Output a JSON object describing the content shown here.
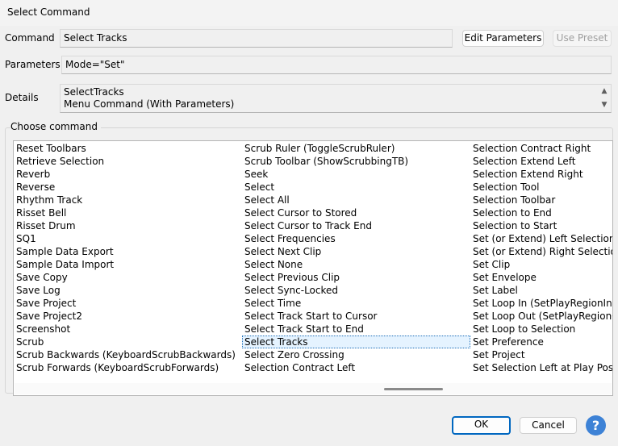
{
  "window": {
    "title": "Select Command"
  },
  "command": {
    "label": "Command",
    "value": "Select Tracks"
  },
  "parameters": {
    "label": "Parameters",
    "value": "Mode=\"Set\""
  },
  "details": {
    "label": "Details",
    "line1": "SelectTracks",
    "line2": "Menu Command (With Parameters)"
  },
  "buttons": {
    "edit_parameters": "Edit Parameters",
    "use_preset": "Use Preset",
    "ok": "OK",
    "cancel": "Cancel",
    "help": "?"
  },
  "choose": {
    "title": "Choose command",
    "col1": [
      "Reset Toolbars",
      "Retrieve Selection",
      "Reverb",
      "Reverse",
      "Rhythm Track",
      "Risset Bell",
      "Risset Drum",
      "SQ1",
      "Sample Data Export",
      "Sample Data Import",
      "Save Copy",
      "Save Log",
      "Save Project",
      "Save Project2",
      "Screenshot",
      "Scrub",
      "Scrub Backwards (KeyboardScrubBackwards)",
      "Scrub Forwards (KeyboardScrubForwards)"
    ],
    "col2": [
      "Scrub Ruler (ToggleScrubRuler)",
      "Scrub Toolbar (ShowScrubbingTB)",
      "Seek",
      "Select",
      "Select All",
      "Select Cursor to Stored",
      "Select Cursor to Track End",
      "Select Frequencies",
      "Select Next Clip",
      "Select None",
      "Select Previous Clip",
      "Select Sync-Locked",
      "Select Time",
      "Select Track Start to Cursor",
      "Select Track Start to End",
      "Select Tracks",
      "Select Zero Crossing",
      "Selection Contract Left"
    ],
    "col3": [
      "Selection Contract Right",
      "Selection Extend Left",
      "Selection Extend Right",
      "Selection Tool",
      "Selection Toolbar",
      "Selection to End",
      "Selection to Start",
      "Set (or Extend) Left Selection",
      "Set (or Extend) Right Selection",
      "Set Clip",
      "Set Envelope",
      "Set Label",
      "Set Loop In (SetPlayRegionIn)",
      "Set Loop Out (SetPlayRegionOut)",
      "Set Loop to Selection",
      "Set Preference",
      "Set Project",
      "Set Selection Left at Play Position"
    ],
    "selected": "Select Tracks"
  }
}
